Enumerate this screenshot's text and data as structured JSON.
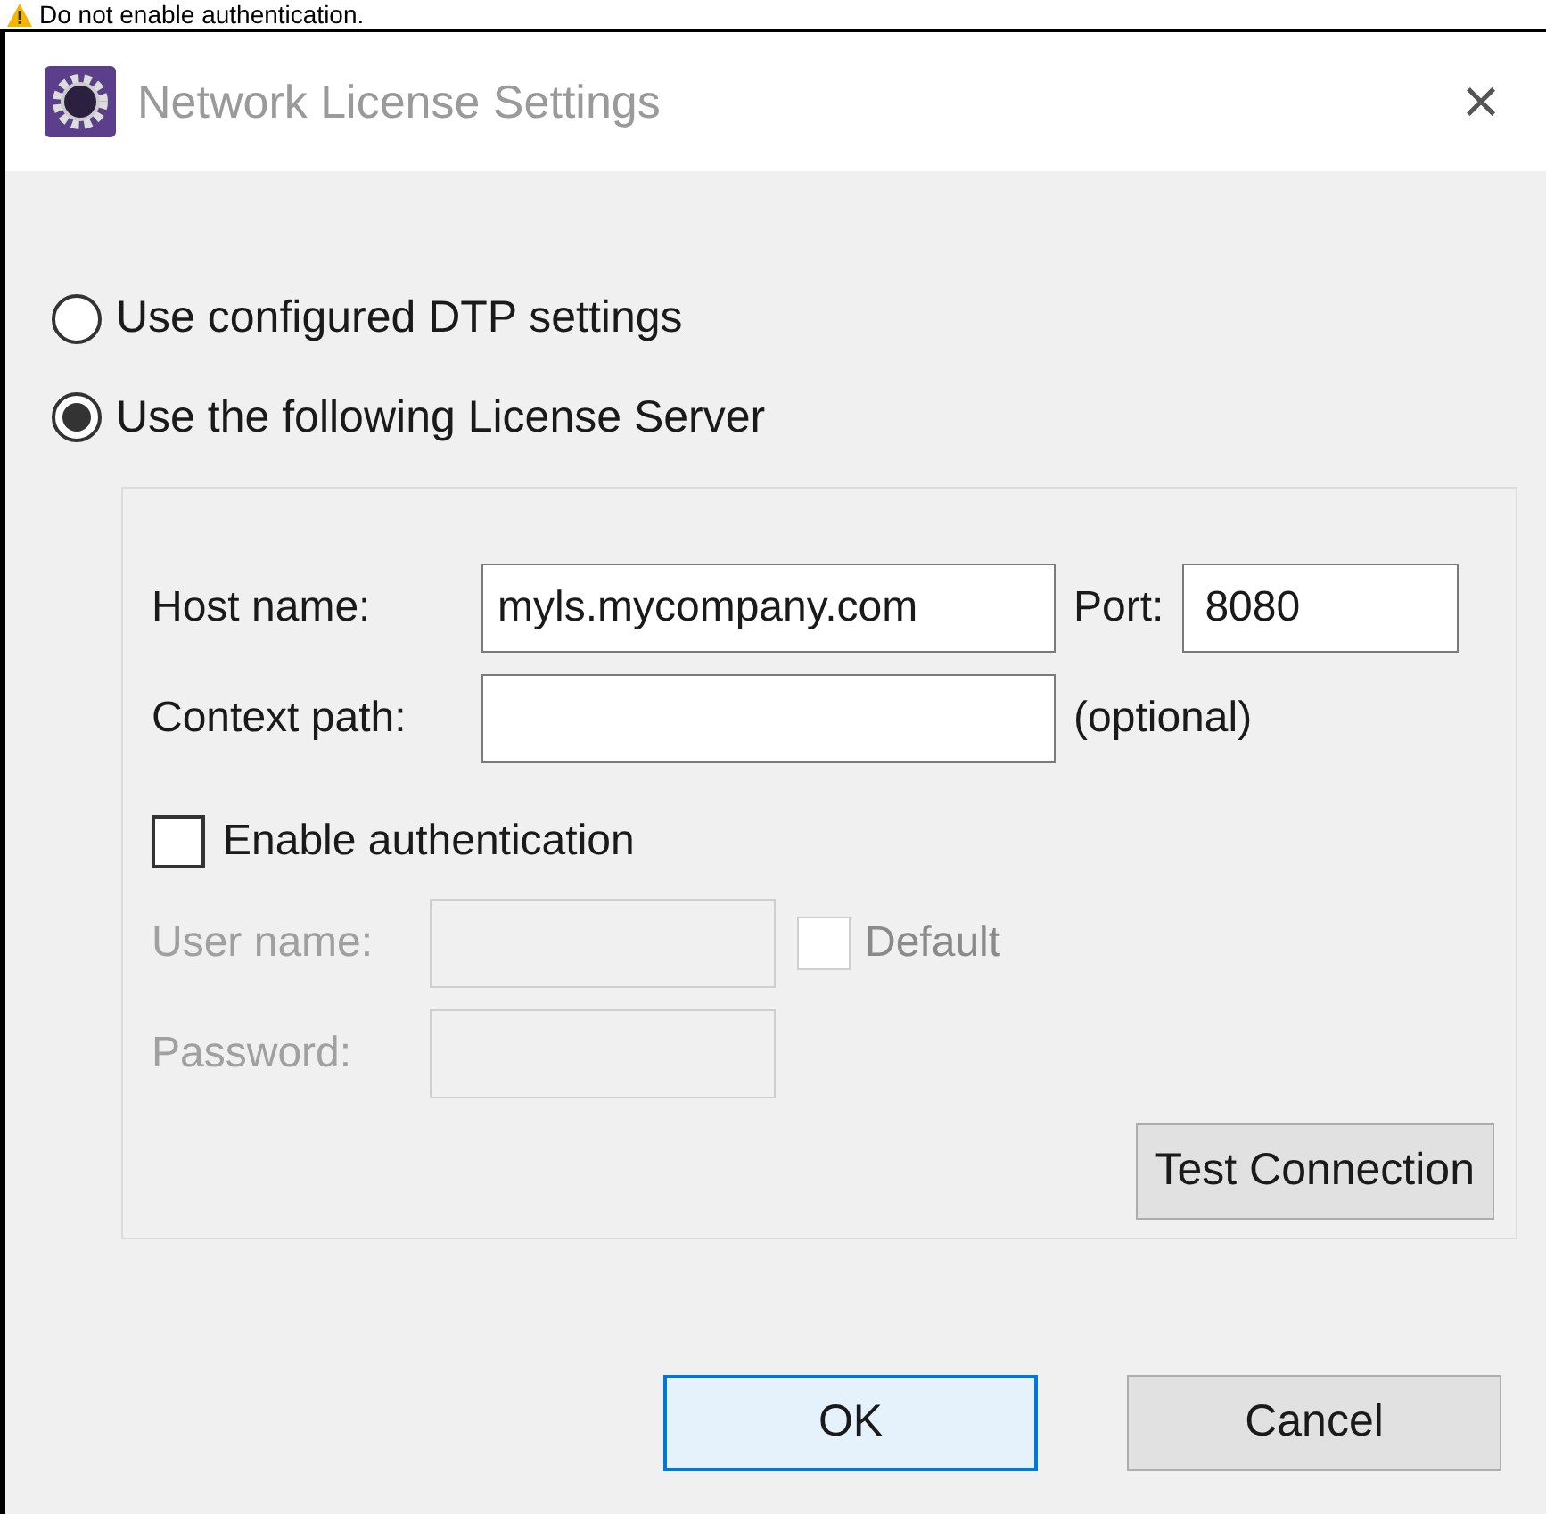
{
  "note": {
    "text": "Do not enable authentication."
  },
  "window": {
    "title": "Network License Settings",
    "close": "×"
  },
  "options": [
    {
      "label": "Use configured DTP settings",
      "selected": false
    },
    {
      "label": "Use the following License Server",
      "selected": true
    }
  ],
  "server": {
    "host_label": "Host name:",
    "host_value": "myls.mycompany.com",
    "port_label": "Port:",
    "port_value": "8080",
    "context_label": "Context path:",
    "optional": "(optional)"
  },
  "auth": {
    "label": "Enable authentication",
    "checked": false,
    "user_label": "User name:",
    "default_label": "Default",
    "default_checked": false,
    "password_label": "Password:",
    "disabled": true
  },
  "test_button": "Test Connection",
  "buttons": [
    {
      "label": "OK",
      "focused": true
    },
    {
      "label": "Cancel",
      "focused": false
    }
  ]
}
